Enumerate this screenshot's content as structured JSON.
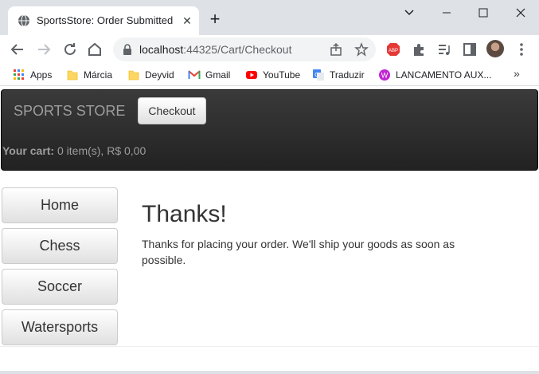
{
  "browser": {
    "tab_title": "SportsStore: Order Submitted",
    "url_host": "localhost",
    "url_rest": ":44325/Cart/Checkout"
  },
  "bookmarks": [
    {
      "label": "Apps",
      "icon": "apps-grid-icon"
    },
    {
      "label": "Márcia",
      "icon": "folder-icon"
    },
    {
      "label": "Deyvid",
      "icon": "folder-icon"
    },
    {
      "label": "Gmail",
      "icon": "gmail-icon"
    },
    {
      "label": "YouTube",
      "icon": "youtube-icon"
    },
    {
      "label": "Traduzir",
      "icon": "translate-icon"
    },
    {
      "label": "LANCAMENTO AUX...",
      "icon": "purple-app-icon"
    }
  ],
  "site": {
    "brand": "SPORTS STORE",
    "checkout_label": "Checkout",
    "cart_label": "Your cart:",
    "cart_summary": " 0 item(s), R$ 0,00"
  },
  "categories": [
    "Home",
    "Chess",
    "Soccer",
    "Watersports"
  ],
  "content": {
    "title": "Thanks!",
    "message": "Thanks for placing your order. We'll ship your goods as soon as possible."
  }
}
